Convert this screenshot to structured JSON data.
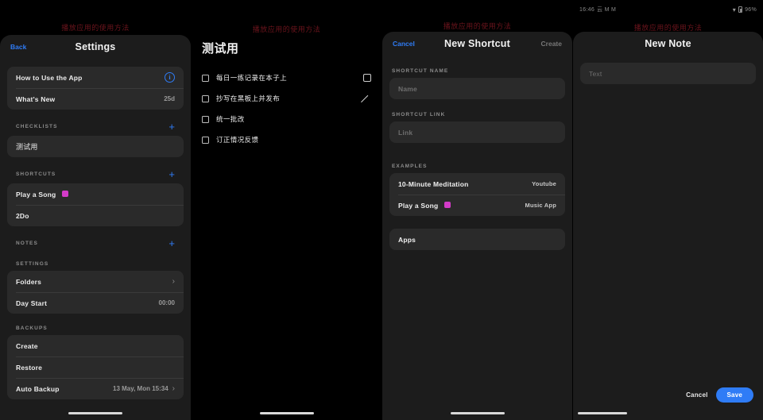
{
  "watermark": "播放应用的使用方法",
  "panel1": {
    "nav": {
      "back": "Back",
      "title": "Settings"
    },
    "help_group": [
      {
        "label": "How to Use the App",
        "value": "",
        "icon": "info-icon"
      },
      {
        "label": "What's New",
        "value": "25d",
        "icon": ""
      }
    ],
    "sections": [
      {
        "title": "CHECKLISTS",
        "action": "+",
        "items": [
          {
            "label": "测试用"
          }
        ]
      },
      {
        "title": "SHORTCUTS",
        "action": "+",
        "items": [
          {
            "label": "Play a Song",
            "badge": true
          },
          {
            "label": "2Do"
          }
        ]
      },
      {
        "title": "NOTES",
        "action": "+",
        "items": []
      },
      {
        "title": "SETTINGS",
        "action": "",
        "items": [
          {
            "label": "Folders",
            "chevron": true
          },
          {
            "label": "Day Start",
            "value": "00:00"
          }
        ]
      },
      {
        "title": "BACKUPS",
        "action": "",
        "items": [
          {
            "label": "Create"
          },
          {
            "label": "Restore"
          },
          {
            "label": "Auto Backup",
            "value": "13 May, Mon 15:34",
            "chevron": true
          }
        ]
      }
    ]
  },
  "panel2": {
    "title": "测试用",
    "items": [
      {
        "text": "每日一练记录在本子上",
        "trailing": "checkbox"
      },
      {
        "text": "抄写在黑板上并发布",
        "trailing": "pencil"
      },
      {
        "text": "统一批改",
        "trailing": ""
      },
      {
        "text": "订正情况反馈",
        "trailing": ""
      }
    ]
  },
  "panel3": {
    "nav": {
      "cancel": "Cancel",
      "title": "New Shortcut",
      "create": "Create"
    },
    "name_label": "SHORTCUT NAME",
    "name_placeholder": "Name",
    "link_label": "SHORTCUT LINK",
    "link_placeholder": "Link",
    "examples_label": "EXAMPLES",
    "examples": [
      {
        "name": "10-Minute Meditation",
        "source": "Youtube",
        "badge": false
      },
      {
        "name": "Play a Song",
        "source": "Music App",
        "badge": true
      }
    ],
    "apps_label": "Apps"
  },
  "panel4": {
    "status": {
      "time": "16:46",
      "icons": "云 M M",
      "battery": "96%"
    },
    "nav": {
      "title": "New Note"
    },
    "text_placeholder": "Text",
    "cancel": "Cancel",
    "save": "Save"
  },
  "colors": {
    "accent": "#2f7cf6",
    "page_bg": "#1c1c1c",
    "card_bg": "#2a2a2a",
    "badge_pink": "#d33bc8",
    "watermark_red": "#7e1822"
  }
}
